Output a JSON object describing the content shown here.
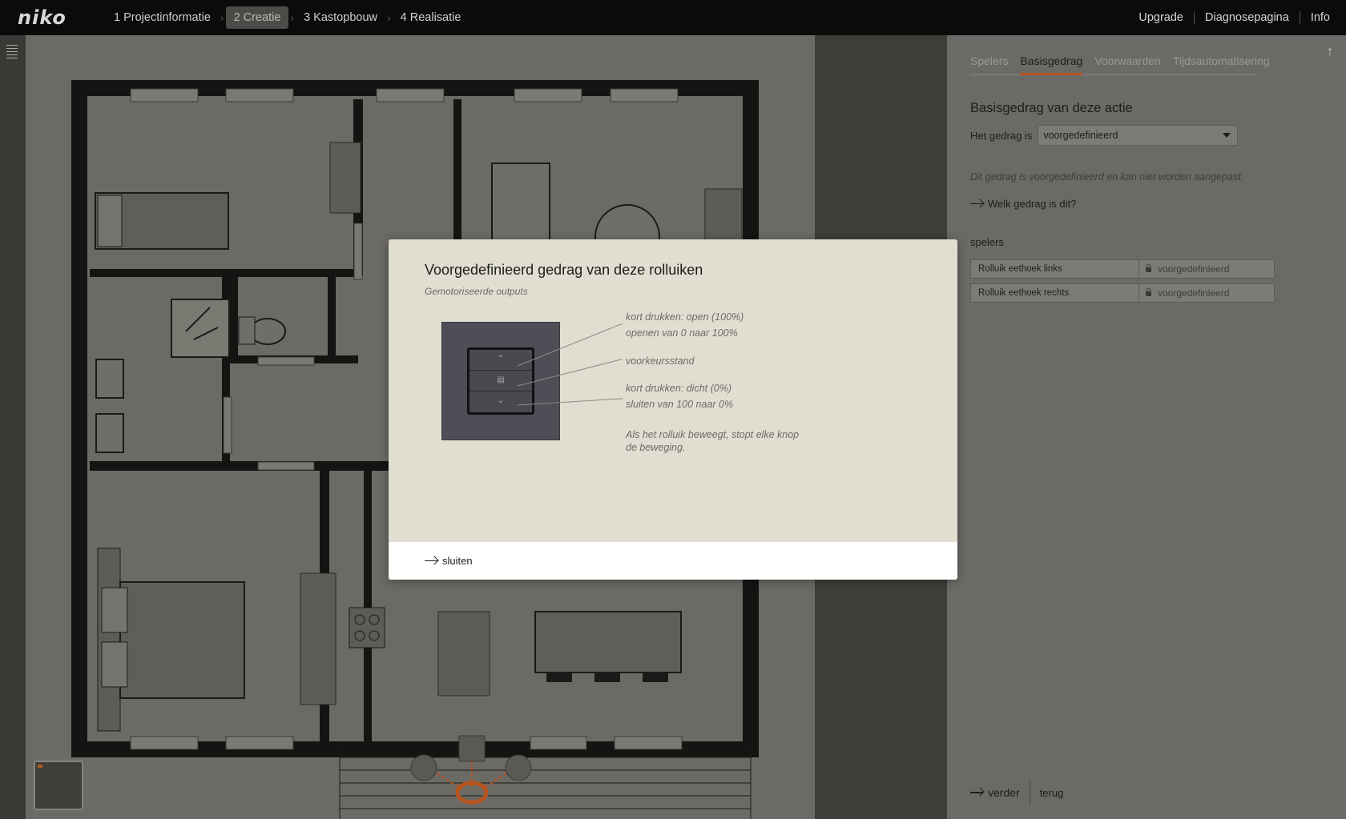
{
  "brand": {
    "logo": "niko"
  },
  "steps": [
    {
      "label": "1 Projectinformatie"
    },
    {
      "label": "2 Creatie"
    },
    {
      "label": "3 Kastopbouw"
    },
    {
      "label": "4 Realisatie"
    }
  ],
  "toplinks": [
    {
      "label": "Upgrade"
    },
    {
      "label": "Diagnosepagina"
    },
    {
      "label": "Info"
    }
  ],
  "panel": {
    "tabs": [
      {
        "label": "Spelers"
      },
      {
        "label": "Basisgedrag"
      },
      {
        "label": "Voorwaarden"
      },
      {
        "label": "Tijdsautomatisering"
      }
    ],
    "title": "Basisgedrag van deze actie",
    "behavior_label": "Het gedrag is",
    "behavior_value": "voorgedefinieerd",
    "note": "Dit gedrag is voorgedefinieerd en kan niet worden aangepast.",
    "what_link": "Welk gedrag is dit?",
    "players_label": "spelers",
    "players": [
      {
        "name": "Rolluik eethoek links",
        "value": "voorgedefinieerd"
      },
      {
        "name": "Rolluik eethoek rechts",
        "value": "voorgedefinieerd"
      }
    ],
    "next_label": "verder",
    "back_label": "terug"
  },
  "modal": {
    "title": "Voorgedefinieerd gedrag van deze rolluiken",
    "subtitle": "Gemotoriseerde outputs",
    "annotations": {
      "up_line1": "kort drukken: open (100%)",
      "up_line2": "openen van 0 naar 100%",
      "mid": "voorkeursstand",
      "down_line1": "kort drukken: dicht (0%)",
      "down_line2": "sluiten van 100 naar 0%",
      "stop_line1": "Als het rolluik beweegt, stopt elke knop",
      "stop_line2": "de beweging."
    },
    "close_label": "sluiten"
  },
  "colors": {
    "accent": "#b8541f",
    "topbar": "#0b0b0b",
    "modal_bg": "#e0ded1"
  }
}
